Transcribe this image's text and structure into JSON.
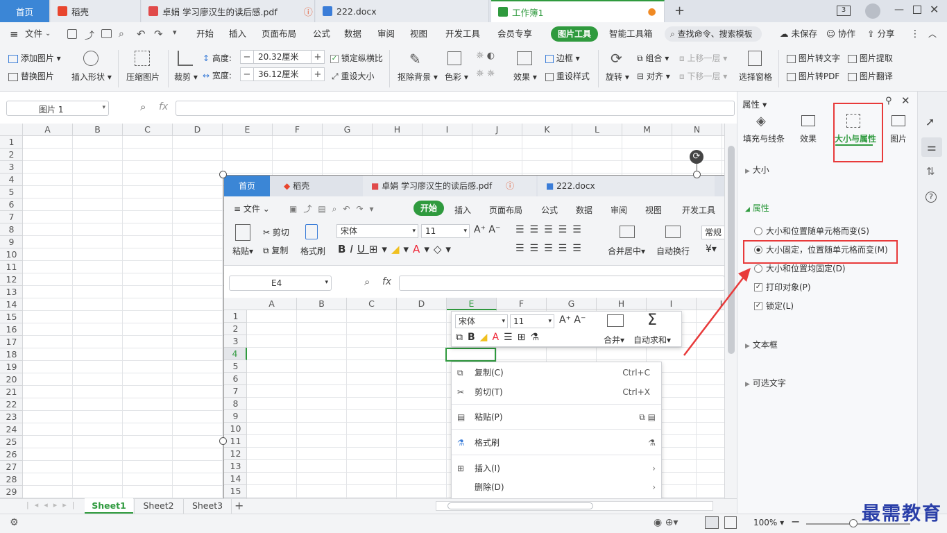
{
  "tabs": [
    {
      "label": "首页"
    },
    {
      "label": "稻壳"
    },
    {
      "label": "卓娟 学习廖汉生的读后感.pdf"
    },
    {
      "label": "222.docx"
    },
    {
      "label": "工作簿1"
    }
  ],
  "window_badge": "3",
  "menu": {
    "file": "文件",
    "items": [
      "开始",
      "插入",
      "页面布局",
      "公式",
      "数据",
      "审阅",
      "视图",
      "开发工具",
      "会员专享"
    ],
    "active": "图片工具",
    "after": [
      "智能工具箱"
    ],
    "search": "查找命令、搜索模板",
    "right": [
      "未保存",
      "协作",
      "分享"
    ]
  },
  "ribbon": {
    "add_image": "添加图片",
    "replace_image": "替换图片",
    "insert_shape": "插入形状",
    "compress": "压缩图片",
    "crop": "裁剪",
    "height_label": "高度:",
    "height_value": "20.32厘米",
    "width_label": "宽度:",
    "width_value": "36.12厘米",
    "lock_ratio": "锁定纵横比",
    "reset_size": "重设大小",
    "remove_bg": "抠除背景",
    "color": "色彩",
    "effect": "效果",
    "border": "边框",
    "reset_style": "重设样式",
    "rotate": "旋转",
    "group": "组合",
    "align": "对齐",
    "bring_forward": "上移一层",
    "send_backward": "下移一层",
    "selection_pane": "选择窗格",
    "img_to_text": "图片转文字",
    "img_extract": "图片提取",
    "img_to_pdf": "图片转PDF",
    "img_translate": "图片翻译"
  },
  "namebox": "图片 1",
  "fx": "fx",
  "columns": [
    "A",
    "B",
    "C",
    "D",
    "E",
    "F",
    "G",
    "H",
    "I",
    "J",
    "K",
    "L",
    "M",
    "N"
  ],
  "rows": [
    "1",
    "2",
    "3",
    "4",
    "5",
    "6",
    "7",
    "8",
    "9",
    "10",
    "11",
    "12",
    "13",
    "14",
    "15",
    "16",
    "17",
    "18",
    "19",
    "20",
    "21",
    "22",
    "23",
    "24",
    "25",
    "26",
    "27",
    "28",
    "29"
  ],
  "sheets": [
    "Sheet1",
    "Sheet2",
    "Sheet3"
  ],
  "zoom": "100%",
  "panel": {
    "title": "属性",
    "tabs": [
      "填充与线条",
      "效果",
      "大小与属性",
      "图片"
    ],
    "sections": {
      "size": "大小",
      "props": "属性",
      "textbox": "文本框",
      "alt": "可选文字"
    },
    "options": [
      "大小和位置随单元格而变(S)",
      "大小固定，位置随单元格而变(M)",
      "大小和位置均固定(D)"
    ],
    "checks": [
      "打印对象(P)",
      "锁定(L)"
    ]
  },
  "watermark": "最需教育",
  "inner": {
    "tabs": [
      "首页",
      "稻壳",
      "卓娟 学习廖汉生的读后感.pdf",
      "222.docx"
    ],
    "file": "文件",
    "menu": [
      "开始",
      "插入",
      "页面布局",
      "公式",
      "数据",
      "审阅",
      "视图",
      "开发工具"
    ],
    "paste": "粘贴",
    "cut": "剪切",
    "copy": "复制",
    "format_painter": "格式刷",
    "font": "宋体",
    "size": "11",
    "merge": "合并居中",
    "wrap": "自动换行",
    "number": "常规",
    "namebox": "E4",
    "columns": [
      "A",
      "B",
      "C",
      "D",
      "E",
      "F",
      "G",
      "H",
      "I",
      "J"
    ],
    "rows": [
      "1",
      "2",
      "3",
      "4",
      "5",
      "6",
      "7",
      "8",
      "9",
      "10",
      "11",
      "12",
      "13",
      "14",
      "15"
    ],
    "mini_font": "宋体",
    "mini_size": "11",
    "mini_merge": "合并",
    "mini_sum": "自动求和",
    "context": [
      {
        "label": "复制(C)",
        "key": "Ctrl+C"
      },
      {
        "label": "剪切(T)",
        "key": "Ctrl+X"
      },
      {
        "label": "粘贴(P)",
        "key": ""
      },
      {
        "label": "格式刷",
        "key": ""
      },
      {
        "label": "插入(I)",
        "key": ""
      },
      {
        "label": "删除(D)",
        "key": ""
      }
    ]
  }
}
